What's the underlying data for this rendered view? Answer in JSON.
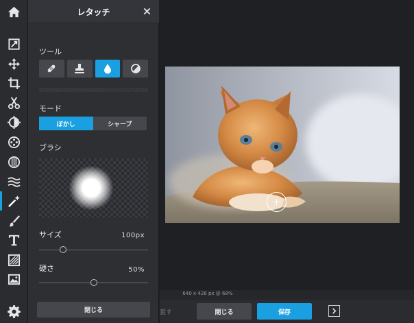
{
  "panel": {
    "title": "レタッチ",
    "tool_label": "ツール",
    "tools": [
      {
        "icon": "bandage-icon",
        "active": false
      },
      {
        "icon": "stamp-icon",
        "active": false
      },
      {
        "icon": "droplet-icon",
        "active": true
      },
      {
        "icon": "contrast-icon",
        "active": false
      }
    ],
    "mode_label": "モード",
    "modes": [
      {
        "label": "ぼかし",
        "active": true
      },
      {
        "label": "シャープ",
        "active": false
      }
    ],
    "brush_label": "ブラシ",
    "size_label": "サイズ",
    "size_value": "100px",
    "size_level": 0.22,
    "hardness_label": "硬さ",
    "hardness_value": "50%",
    "hardness_level": 0.5,
    "close_label": "閉じる"
  },
  "canvas": {
    "status": "640 x 426 px @ 68%"
  },
  "bottom": {
    "undo_label": "直す",
    "close_label": "閉じる",
    "save_label": "保存"
  },
  "colors": {
    "accent": "#1a9fe0",
    "panel_bg": "#2e2f33",
    "rail_bg": "#2b2c30",
    "workspace_bg": "#1f2023"
  }
}
